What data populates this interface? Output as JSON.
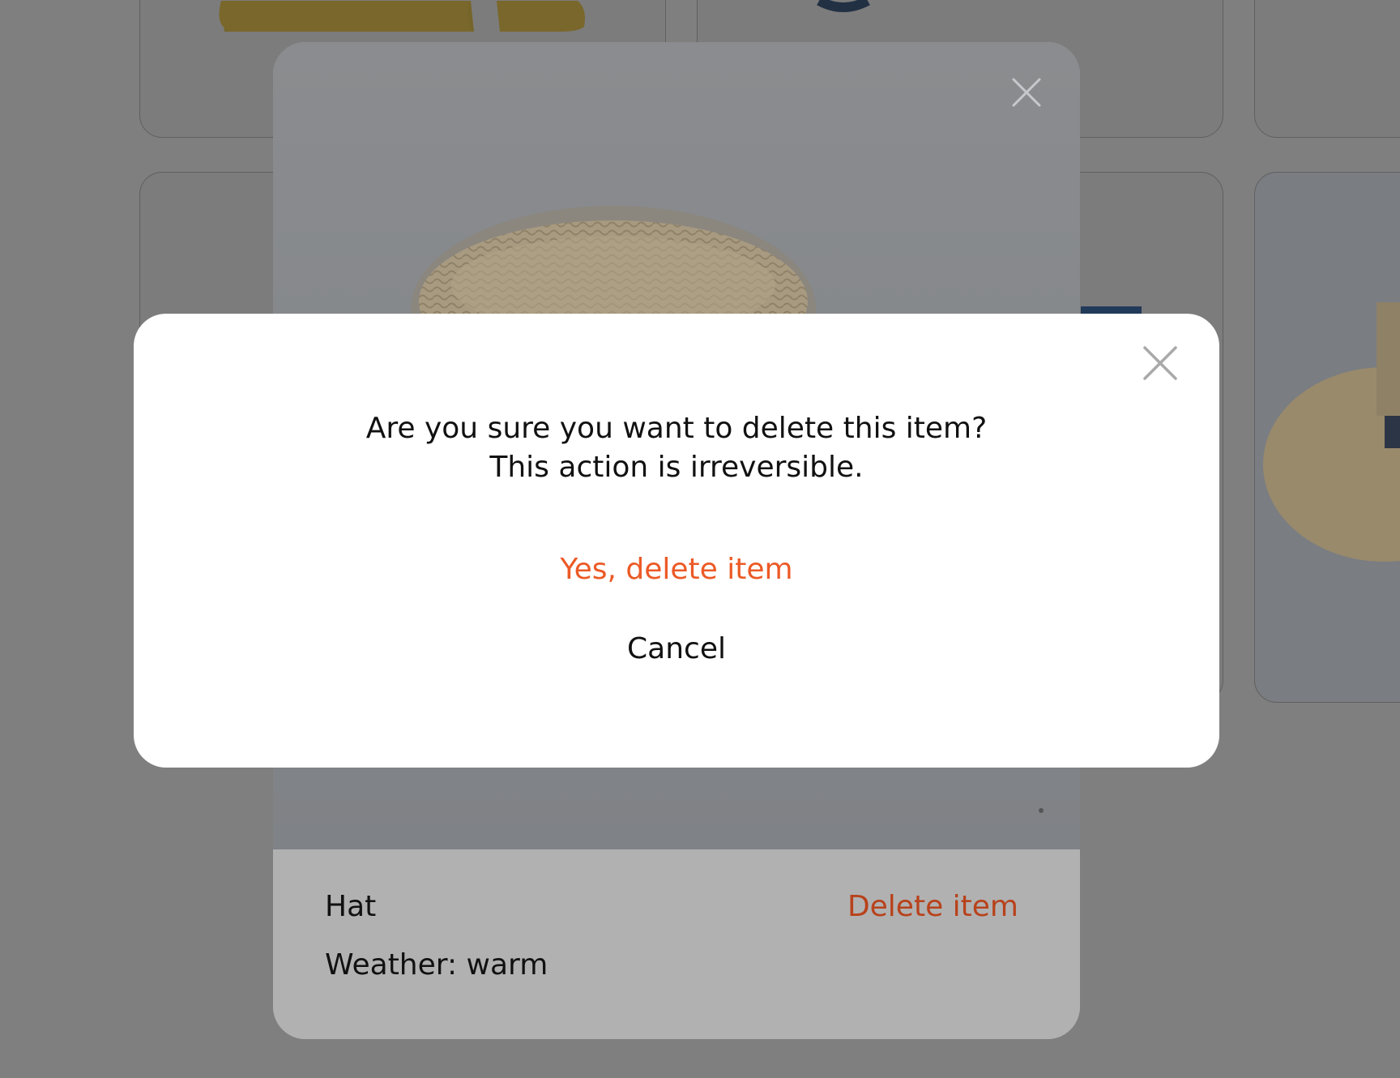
{
  "background": {
    "overlay_color": "#7f7f7f"
  },
  "item_modal": {
    "close_icon": "close-icon",
    "image_alt": "straw hat",
    "name": "Hat",
    "weather": "Weather: warm",
    "delete_label": "Delete item",
    "delete_color": "#b8421b"
  },
  "dialog": {
    "message_line1": "Are you sure you want to delete this item?",
    "message_line2": "This action is irreversible.",
    "confirm_label": "Yes, delete item",
    "confirm_color": "#ec5a26",
    "cancel_label": "Cancel",
    "close_icon": "close-icon"
  }
}
